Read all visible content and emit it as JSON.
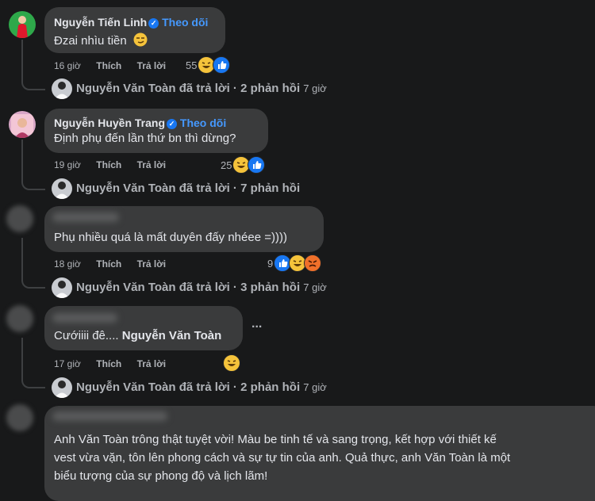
{
  "actions": {
    "like": "Thích",
    "reply": "Trả lời"
  },
  "reply_author": "Nguyễn Văn Toàn",
  "reply_verb": "đã trả lời",
  "comments": [
    {
      "author": "Nguyễn Tiến Linh",
      "follow": "Theo dõi",
      "text": "Đzai nhìu tiền",
      "time": "16 giờ",
      "reaction_count": "55",
      "replies": {
        "count_text": "2 phản hồi",
        "time": "7 giờ"
      }
    },
    {
      "author": "Nguyễn Huyền Trang",
      "follow": "Theo dõi",
      "text": "Định phụ đến lần thứ bn thì dừng?",
      "time": "19 giờ",
      "reaction_count": "25",
      "replies": {
        "count_text": "7 phản hồi",
        "time": ""
      }
    },
    {
      "author": "",
      "text": "Phụ nhiều quá là mất duyên đấy nhéee =))))",
      "time": "18 giờ",
      "reaction_count": "9",
      "replies": {
        "count_text": "3 phản hồi",
        "time": "7 giờ"
      }
    },
    {
      "author": "",
      "text_prefix": "Cướiiii đê....",
      "mention": "Nguyễn Văn Toàn",
      "time": "17 giờ",
      "more": "...",
      "replies": {
        "count_text": "2 phản hồi",
        "time": "7 giờ"
      }
    },
    {
      "author": "",
      "text_lines": [
        "Anh Văn Toàn trông thật tuyệt vời! Màu be tinh tế và sang trọng, kết hợp với thiết kế",
        "vest vừa vặn, tôn lên phong cách và sự tự tin của anh. Quả thực, anh Văn Toàn là một",
        "biểu tượng của sự phong độ và lịch lãm!"
      ]
    }
  ],
  "colors": {
    "background": "#18191a",
    "bubble": "#3a3b3c",
    "link": "#4599ff",
    "muted": "#b0b3b8",
    "text": "#e4e6eb"
  }
}
